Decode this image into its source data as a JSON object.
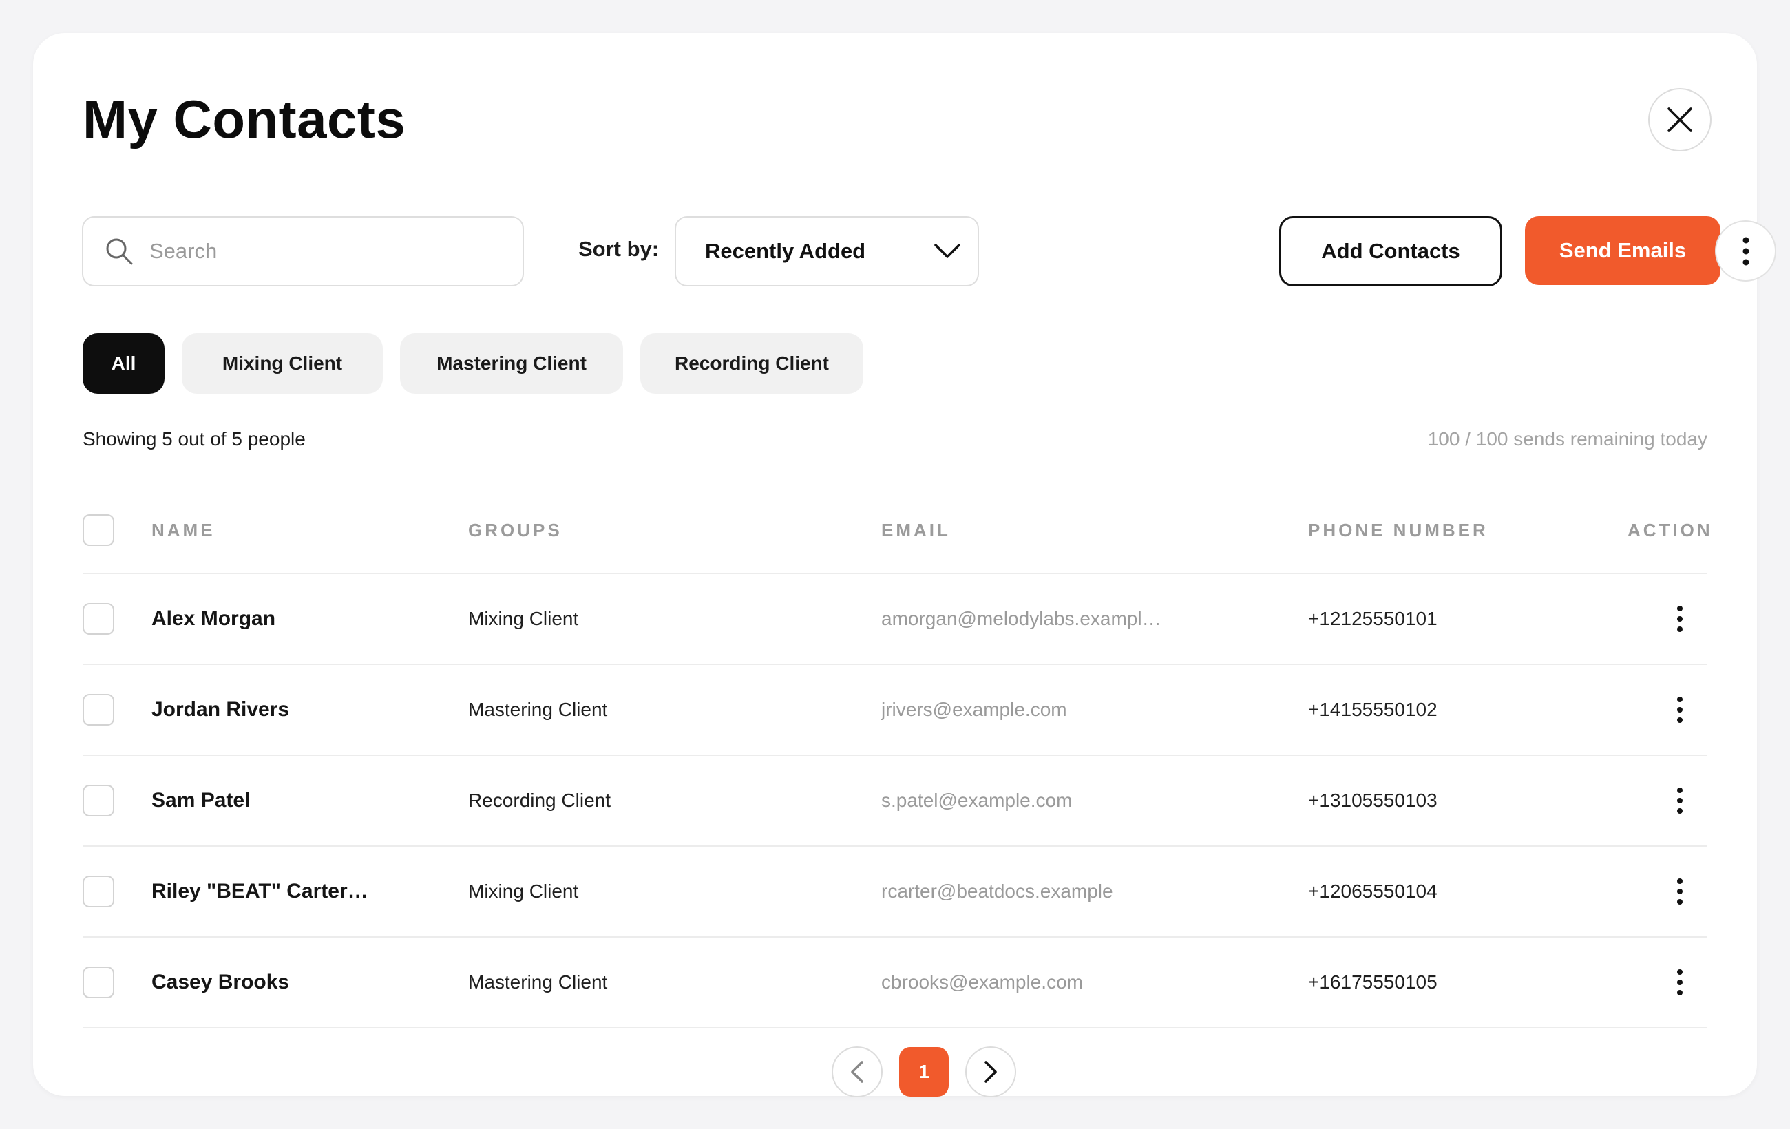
{
  "header": {
    "title": "My Contacts"
  },
  "toolbar": {
    "search_placeholder": "Search",
    "sort_label": "Sort by:",
    "sort_value": "Recently Added",
    "add_contacts_label": "Add Contacts",
    "send_emails_label": "Send Emails"
  },
  "filters": [
    {
      "label": "All",
      "active": true
    },
    {
      "label": "Mixing Client",
      "active": false
    },
    {
      "label": "Mastering Client",
      "active": false
    },
    {
      "label": "Recording Client",
      "active": false
    }
  ],
  "summary": {
    "showing": "Showing 5 out of 5 people",
    "remaining": "100 / 100 sends remaining today"
  },
  "table": {
    "columns": [
      "NAME",
      "GROUPS",
      "EMAIL",
      "PHONE NUMBER",
      "ACTION"
    ],
    "rows": [
      {
        "name": "Alex Morgan",
        "group": "Mixing Client",
        "email": "amorgan@melodylabs.exampl…",
        "phone": "+12125550101"
      },
      {
        "name": "Jordan Rivers",
        "group": "Mastering Client",
        "email": "jrivers@example.com",
        "phone": "+14155550102"
      },
      {
        "name": "Sam Patel",
        "group": "Recording Client",
        "email": "s.patel@example.com",
        "phone": "+13105550103"
      },
      {
        "name": "Riley \"BEAT\" Carter…",
        "group": "Mixing Client",
        "email": "rcarter@beatdocs.example",
        "phone": "+12065550104"
      },
      {
        "name": "Casey Brooks",
        "group": "Mastering Client",
        "email": "cbrooks@example.com",
        "phone": "+16175550105"
      }
    ]
  },
  "pagination": {
    "current_page": "1"
  },
  "colors": {
    "accent": "#f15a2c",
    "active_chip": "#0e0e0e",
    "chip_bg": "#f1f1f1"
  },
  "icons": {
    "close": "close-icon",
    "search": "search-icon",
    "sort": "chevron-down-icon",
    "more": "more-vertical-icon",
    "prev": "chevron-left-icon",
    "next": "chevron-right-icon"
  }
}
